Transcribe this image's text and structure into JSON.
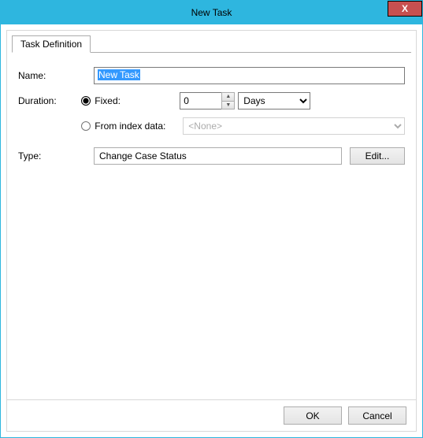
{
  "title": "New Task",
  "close_x": "X",
  "tab": {
    "label": "Task Definition"
  },
  "form": {
    "name_label": "Name:",
    "name_value": "New Task",
    "duration_label": "Duration:",
    "fixed_label": "Fixed:",
    "fixed_value": "0",
    "unit_value": "Days",
    "from_index_label": "From index data:",
    "from_index_value": "<None>",
    "type_label": "Type:",
    "type_value": "Change Case Status",
    "edit_label": "Edit..."
  },
  "buttons": {
    "ok": "OK",
    "cancel": "Cancel"
  }
}
